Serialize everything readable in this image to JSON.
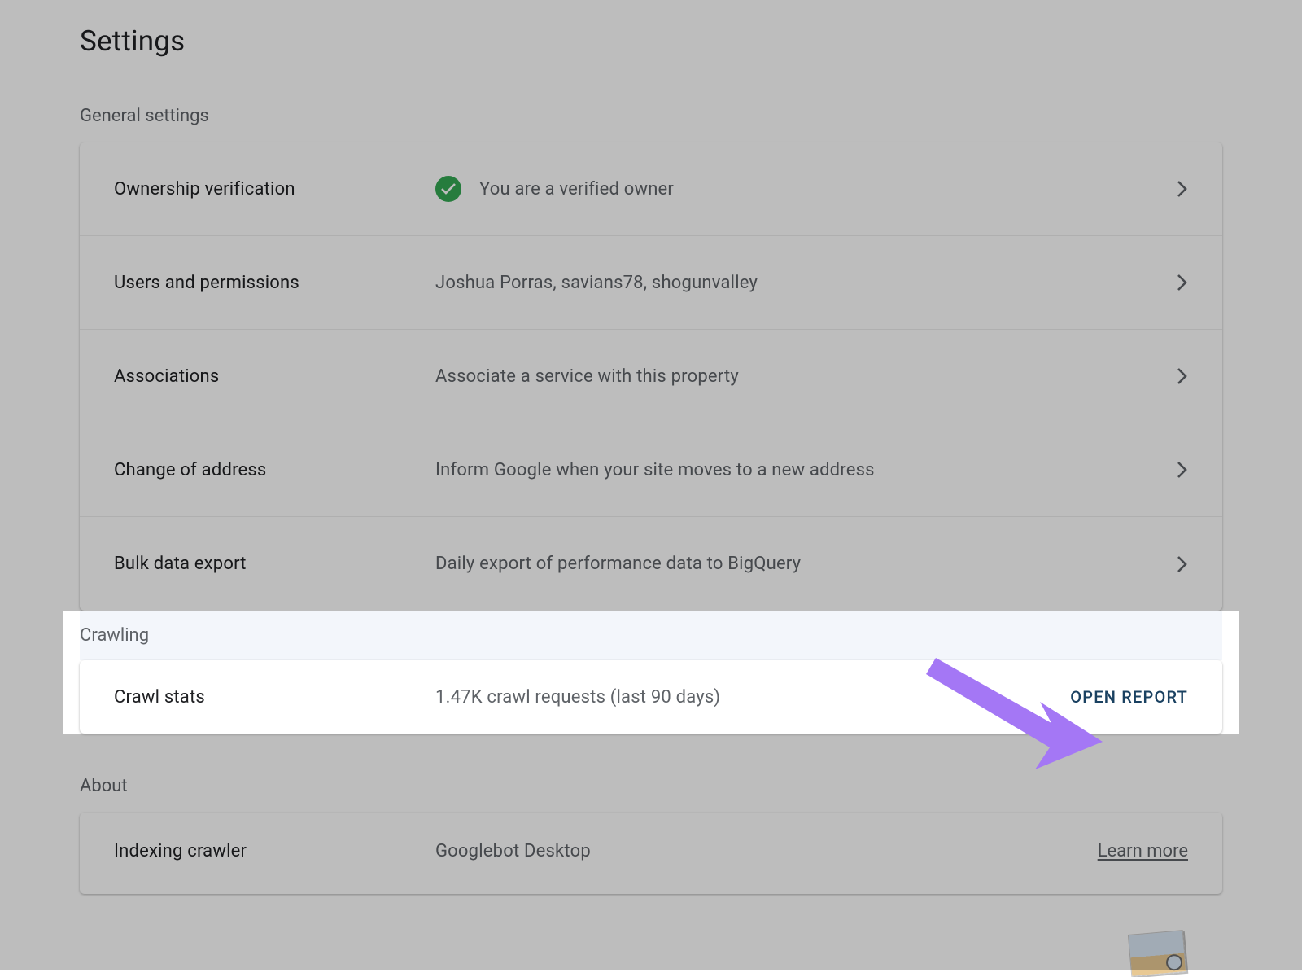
{
  "page_title": "Settings",
  "general": {
    "heading": "General settings",
    "rows": {
      "ownership": {
        "label": "Ownership verification",
        "desc": "You are a verified owner",
        "verified": true
      },
      "users": {
        "label": "Users and permissions",
        "desc": "Joshua Porras, savians78, shogunvalley"
      },
      "associations": {
        "label": "Associations",
        "desc": "Associate a service with this property"
      },
      "address": {
        "label": "Change of address",
        "desc": "Inform Google when your site moves to a new address"
      },
      "export": {
        "label": "Bulk data export",
        "desc": "Daily export of performance data to BigQuery"
      }
    }
  },
  "crawling": {
    "heading": "Crawling",
    "crawl_stats": {
      "label": "Crawl stats",
      "desc": "1.47K crawl requests (last 90 days)",
      "action": "OPEN REPORT"
    }
  },
  "about": {
    "heading": "About",
    "indexing": {
      "label": "Indexing crawler",
      "desc": "Googlebot Desktop",
      "learn_more": "Learn more"
    }
  }
}
